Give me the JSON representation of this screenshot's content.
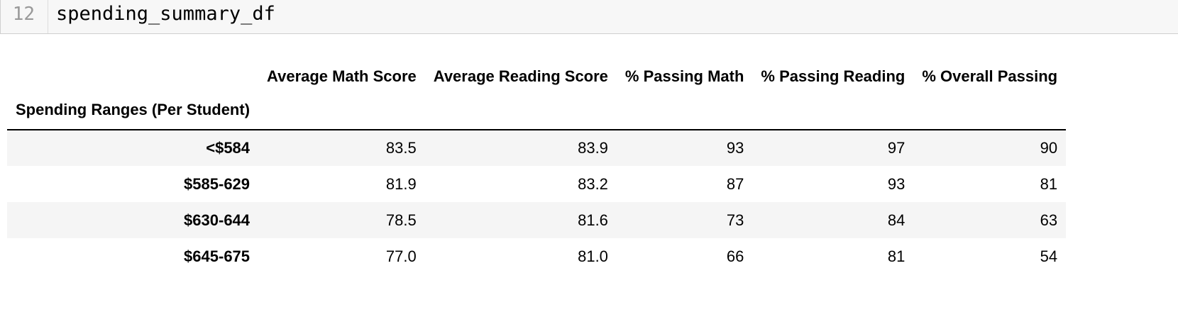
{
  "code_cell": {
    "line_number": "12",
    "code": "spending_summary_df"
  },
  "table": {
    "index_name": "Spending Ranges (Per Student)",
    "columns": [
      "Average Math Score",
      "Average Reading Score",
      "% Passing Math",
      "% Passing Reading",
      "% Overall Passing"
    ],
    "rows": [
      {
        "index": "<$584",
        "values": [
          "83.5",
          "83.9",
          "93",
          "97",
          "90"
        ]
      },
      {
        "index": "$585-629",
        "values": [
          "81.9",
          "83.2",
          "87",
          "93",
          "81"
        ]
      },
      {
        "index": "$630-644",
        "values": [
          "78.5",
          "81.6",
          "73",
          "84",
          "63"
        ]
      },
      {
        "index": "$645-675",
        "values": [
          "77.0",
          "81.0",
          "66",
          "81",
          "54"
        ]
      }
    ]
  }
}
